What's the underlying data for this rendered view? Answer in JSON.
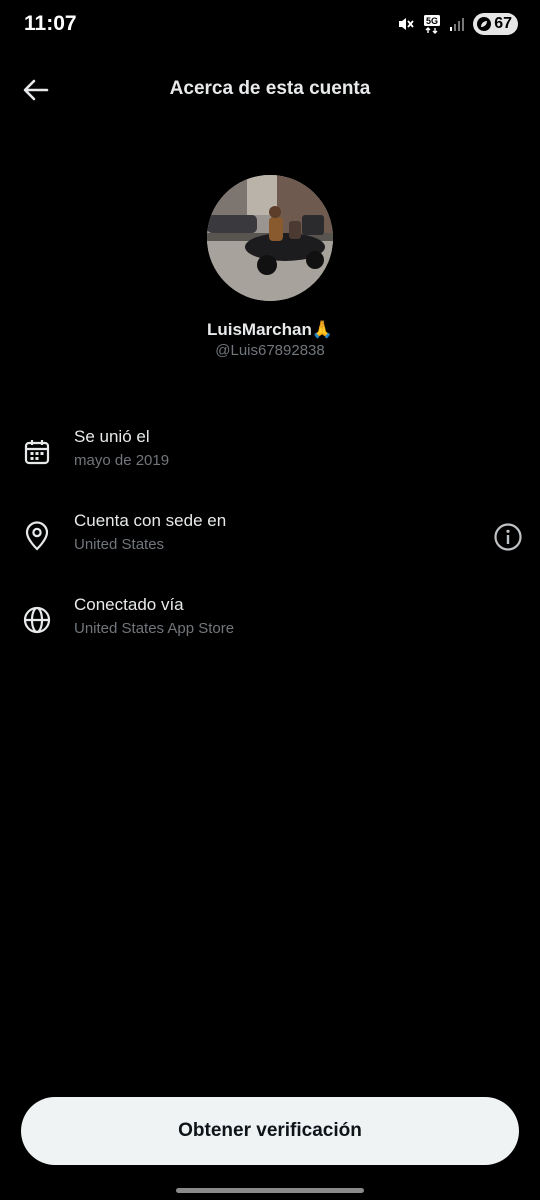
{
  "status_bar": {
    "time": "11:07",
    "network": "5G",
    "battery_level": "67",
    "icons": [
      "mute-icon",
      "5g-icon",
      "signal-icon",
      "battery-icon"
    ]
  },
  "header": {
    "title": "Acerca de esta cuenta",
    "back_icon": "arrow-left-icon"
  },
  "profile": {
    "display_name": "LuisMarchan🙏",
    "handle": "@Luis67892838"
  },
  "info": [
    {
      "icon": "calendar-icon",
      "title": "Se unió el",
      "value": "mayo de 2019"
    },
    {
      "icon": "location-pin-icon",
      "title": "Cuenta con sede en",
      "value": "United States",
      "action_icon": "info-icon"
    },
    {
      "icon": "globe-icon",
      "title": "Conectado vía",
      "value": "United States App Store"
    }
  ],
  "cta": {
    "label": "Obtener verificación"
  },
  "colors": {
    "background": "#000000",
    "primary_text": "#e7e9ea",
    "secondary_text": "#71767b",
    "button_bg": "#eff3f4",
    "button_text": "#0f1419"
  }
}
